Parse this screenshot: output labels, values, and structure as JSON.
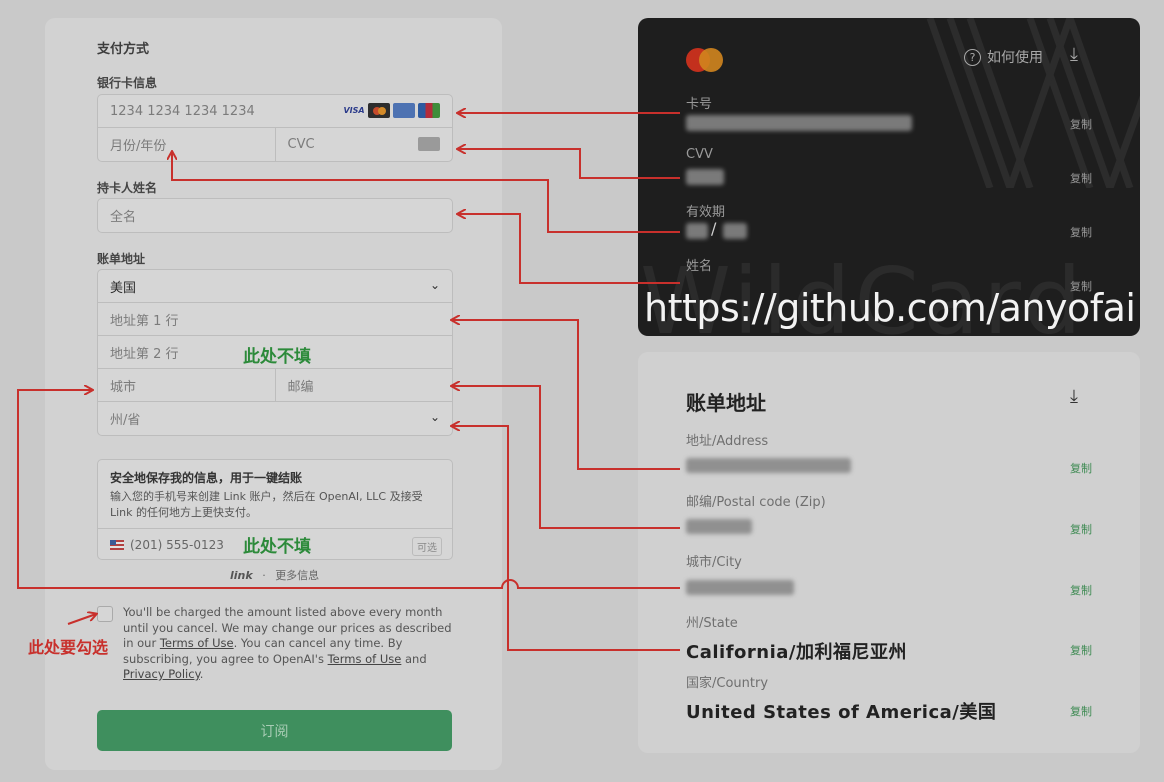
{
  "form": {
    "title": "支付方式",
    "card_info_label": "银行卡信息",
    "card_number_placeholder": "1234 1234 1234 1234",
    "card_brands": [
      "VISA",
      "Mastercard",
      "AMEX",
      "JCB"
    ],
    "expiry_placeholder": "月份/年份",
    "cvc_placeholder": "CVC",
    "cardholder_label": "持卡人姓名",
    "fullname_placeholder": "全名",
    "billing_label": "账单地址",
    "country_value": "美国",
    "address1_placeholder": "地址第 1 行",
    "address2_placeholder": "地址第 2 行",
    "city_placeholder": "城市",
    "postal_placeholder": "邮编",
    "state_placeholder": "州/省",
    "link": {
      "title": "安全地保存我的信息，用于一键结账",
      "desc": "输入您的手机号来创建 Link 账户，然后在 OpenAI, LLC 及接受 Link 的任何地方上更快支付。",
      "phone_placeholder": "(201) 555-0123",
      "optional": "可选",
      "brand": "link",
      "sep": "·",
      "more": "更多信息"
    },
    "terms": {
      "part1": "You'll be charged the amount listed above every month until you cancel. We may change our prices as described in our ",
      "terms_link": "Terms of Use",
      "part2": ". You can cancel any time. By subscribing, you agree to OpenAI's ",
      "terms_link2": "Terms of Use",
      "part3": " and ",
      "privacy_link": "Privacy Policy",
      "part4": "."
    },
    "subscribe_label": "订阅"
  },
  "annotations": {
    "skip_line2": "此处不填",
    "skip_phone": "此处不填",
    "check_here": "此处要勾选"
  },
  "card_panel": {
    "howto": "如何使用",
    "card_number_label": "卡号",
    "cvv_label": "CVV",
    "expiry_label": "有效期",
    "expiry_sep": "/",
    "name_label": "姓名",
    "copy": "复制",
    "watermark": "WildCard",
    "url": "https://github.com/anyofai"
  },
  "billing_panel": {
    "title": "账单地址",
    "address_label": "地址/Address",
    "postal_label": "邮编/Postal code (Zip)",
    "city_label": "城市/City",
    "state_label": "州/State",
    "state_value": "California/加利福尼亚州",
    "country_label": "国家/Country",
    "country_value": "United States of America/美国",
    "copy": "复制"
  },
  "colors": {
    "arrow": "#c8302c",
    "subscribe_bg": "#3f8f5e",
    "copy_green": "#3d8a52",
    "card_bg": "#1e1e1e"
  }
}
